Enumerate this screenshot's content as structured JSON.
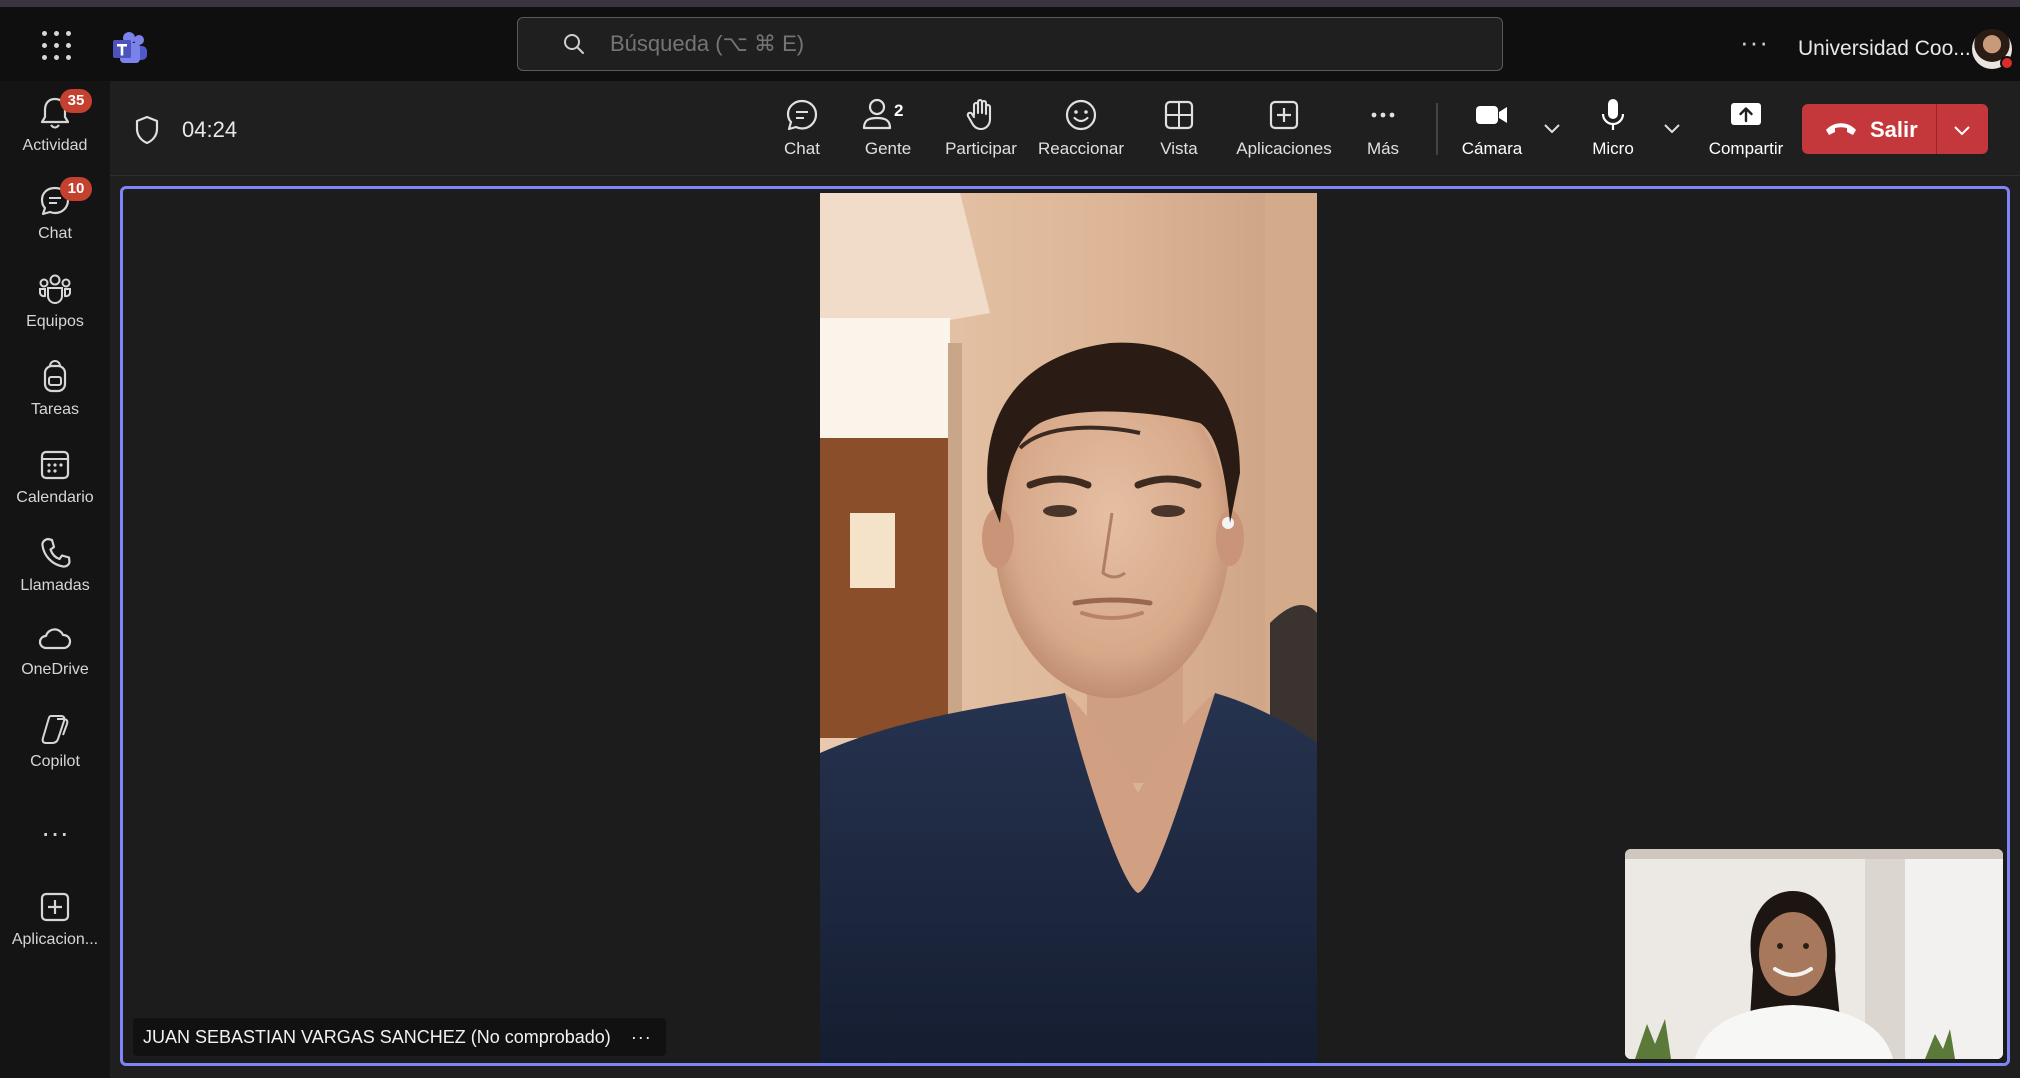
{
  "titlebar": {
    "search_placeholder": "Búsqueda (⌥ ⌘ E)",
    "org_name": "Universidad Coo...",
    "more": "···"
  },
  "rail": {
    "items": [
      {
        "label": "Actividad",
        "badge": "35",
        "icon": "bell-icon"
      },
      {
        "label": "Chat",
        "badge": "10",
        "icon": "chat-icon"
      },
      {
        "label": "Equipos",
        "icon": "teams-icon"
      },
      {
        "label": "Tareas",
        "icon": "backpack-icon"
      },
      {
        "label": "Calendario",
        "icon": "calendar-icon"
      },
      {
        "label": "Llamadas",
        "icon": "phone-icon"
      },
      {
        "label": "OneDrive",
        "icon": "cloud-icon"
      },
      {
        "label": "Copilot",
        "icon": "copilot-icon"
      },
      {
        "label": "Aplicacion...",
        "icon": "add-app-icon"
      }
    ],
    "more": "···"
  },
  "toolbar": {
    "timer": "04:24",
    "chat": "Chat",
    "people": "Gente",
    "people_count": "2",
    "raise_hand": "Participar",
    "react": "Reaccionar",
    "view": "Vista",
    "apps": "Aplicaciones",
    "more": "Más",
    "camera": "Cámara",
    "mic": "Micro",
    "share": "Compartir",
    "leave": "Salir"
  },
  "stage": {
    "participant_name": "JUAN SEBASTIAN VARGAS SANCHEZ (No comprobado)",
    "name_more": "···"
  },
  "colors": {
    "accent": "#7f85f5",
    "leave": "#c4373b",
    "badge": "#c4402f"
  }
}
